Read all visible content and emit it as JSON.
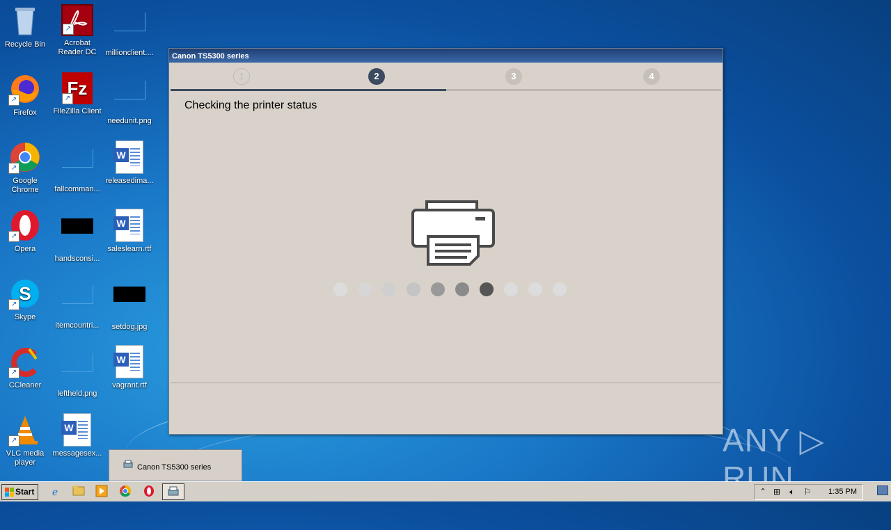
{
  "desktop": {
    "icons": [
      {
        "label": "Recycle Bin"
      },
      {
        "label": "Acrobat Reader DC"
      },
      {
        "label": "millionclient...."
      },
      {
        "label": "Firefox"
      },
      {
        "label": "FileZilla Client"
      },
      {
        "label": "needunit.png"
      },
      {
        "label": "Google Chrome"
      },
      {
        "label": "fallcomman..."
      },
      {
        "label": "releasedima..."
      },
      {
        "label": "Opera"
      },
      {
        "label": "handsconsi..."
      },
      {
        "label": "saleslearn.rtf"
      },
      {
        "label": "Skype"
      },
      {
        "label": "itemcountri..."
      },
      {
        "label": "setdog.jpg"
      },
      {
        "label": "CCleaner"
      },
      {
        "label": "leftheld.png"
      },
      {
        "label": "vagrant.rtf"
      },
      {
        "label": "VLC media player"
      },
      {
        "label": "messagesex..."
      }
    ]
  },
  "dialog": {
    "title": "Canon TS5300 series",
    "steps": [
      "1",
      "2",
      "3",
      "4"
    ],
    "active_step": 2,
    "status_title": "Checking the printer status",
    "loading_dot_colors": [
      "#dcdcdc",
      "#d6d6d6",
      "#cfcfcf",
      "#c4c4c4",
      "#999999",
      "#8a8a8a",
      "#555555",
      "#dcdcdc",
      "#dcdcdc",
      "#dcdcdc"
    ]
  },
  "taskbar": {
    "start_label": "Start",
    "thumbnail_title": "Canon TS5300 series",
    "clock": "1:35 PM"
  },
  "watermark": "ANY ▷ RUN"
}
